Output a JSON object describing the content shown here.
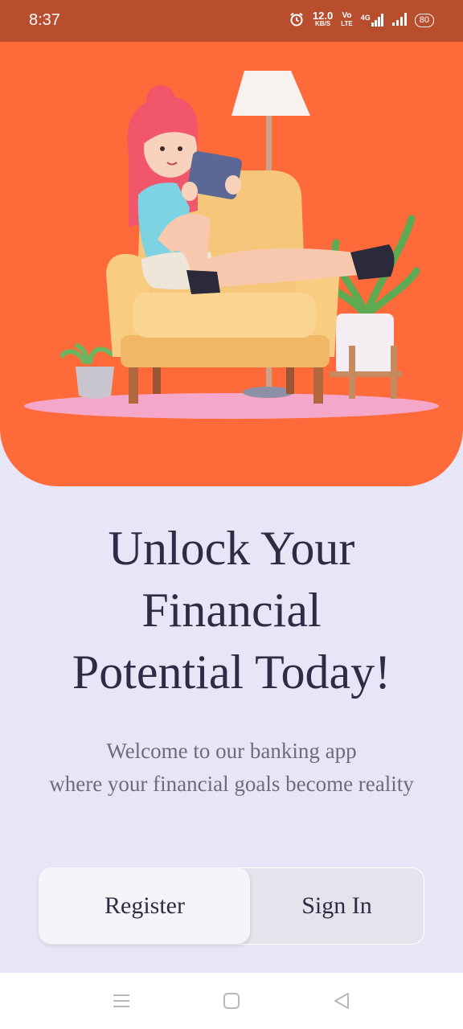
{
  "status_bar": {
    "time": "8:37",
    "net_speed": "12.0",
    "net_unit": "KB/S",
    "volte_top": "Vo",
    "volte_bottom": "LTE",
    "network": "4G",
    "battery": "80",
    "icons": [
      "alarm-icon",
      "volte-icon",
      "signal-icon",
      "wifi-signal-icon",
      "battery-icon"
    ]
  },
  "hero": {
    "illustration": "woman-on-armchair-with-tablet-illustration",
    "colors": {
      "background": "#FF6A3A",
      "chair": "#F6C67A",
      "hair": "#F2566A"
    }
  },
  "headline": {
    "line1": "Unlock Your",
    "line2": "Financial",
    "line3": "Potential Today!"
  },
  "subtitle": {
    "line1": "Welcome to our banking app",
    "line2": "where your financial goals become reality"
  },
  "auth_toggle": {
    "register_label": "Register",
    "signin_label": "Sign In",
    "selected": "Register"
  },
  "nav_bar": {
    "icons": [
      "menu-icon",
      "home-icon",
      "back-icon"
    ]
  },
  "colors": {
    "page_background": "#E6E6F7",
    "accent": "#FF6A3A",
    "status_bar": "#B84E2E",
    "text_primary": "#2F2B45",
    "text_secondary": "#6E6C7C"
  }
}
